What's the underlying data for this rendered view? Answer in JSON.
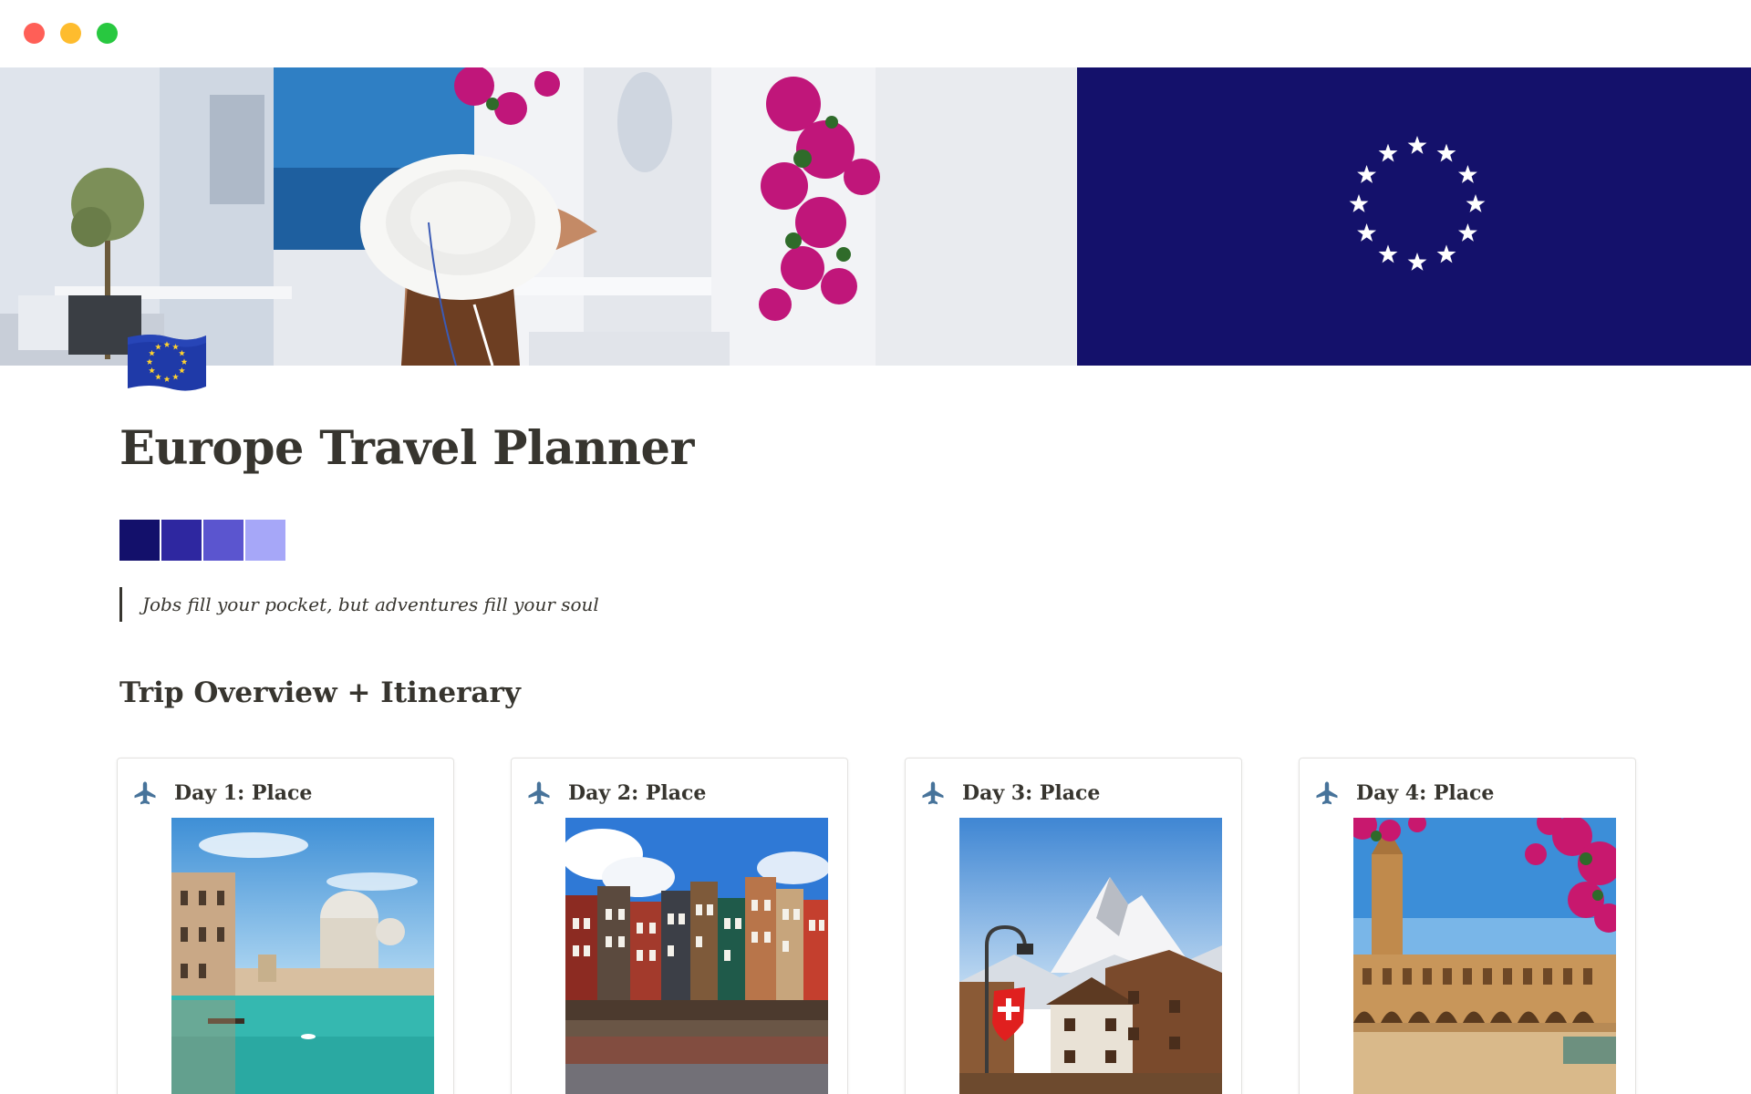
{
  "window": {
    "buttons": [
      "close",
      "minimize",
      "zoom"
    ]
  },
  "cover": {
    "left_image": "santorini-woman-sun-hat-photo",
    "right_image": "eu-flag",
    "flag_color": "#14116b",
    "star_color": "#ffffff"
  },
  "page": {
    "icon": "eu-flag-emoji",
    "title": "Europe Travel Planner",
    "palette": [
      "#13106b",
      "#2e27a0",
      "#5b55cf",
      "#a6a7f8"
    ],
    "quote": "Jobs fill your pocket, but adventures fill your soul",
    "section_heading": "Trip Overview + Itinerary"
  },
  "cards": [
    {
      "icon": "airplane-icon",
      "title": "Day 1: Place",
      "image": "venice-grand-canal-photo"
    },
    {
      "icon": "airplane-icon",
      "title": "Day 2: Place",
      "image": "amsterdam-canal-houses-photo"
    },
    {
      "icon": "airplane-icon",
      "title": "Day 3: Place",
      "image": "zermatt-matterhorn-swiss-flag-photo"
    },
    {
      "icon": "airplane-icon",
      "title": "Day 4: Place",
      "image": "seville-plaza-de-espana-photo"
    }
  ],
  "colors": {
    "text": "#37352f",
    "airplane_icon": "#47739a",
    "card_border": "#e3e2e0"
  }
}
